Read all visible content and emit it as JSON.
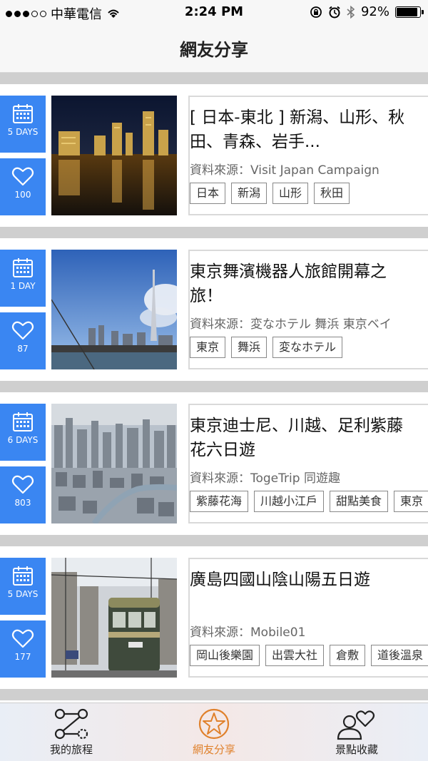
{
  "status": {
    "carrier": "中華電信",
    "time": "2:24 PM",
    "battery": "92%",
    "battery_level": 0.92
  },
  "nav": {
    "title": "網友分享"
  },
  "cards": [
    {
      "days": "5 DAYS",
      "likes": "100",
      "title": "[ 日本-東北 ] 新潟、山形、秋田、青森、岩手...",
      "source": "資料來源：Visit Japan Campaign",
      "tags": [
        "日本",
        "新潟",
        "山形",
        "秋田"
      ]
    },
    {
      "days": "1 DAY",
      "likes": "87",
      "title": "東京舞濱機器人旅館開幕之旅！",
      "source": "資料來源：変なホテル 舞浜 東京ベイ",
      "tags": [
        "東京",
        "舞浜",
        "変なホテル"
      ]
    },
    {
      "days": "6 DAYS",
      "likes": "803",
      "title": "東京迪士尼、川越、足利紫藤花六日遊",
      "source": "資料來源：TogeTrip 同遊趣",
      "tags": [
        "紫藤花海",
        "川越小江戶",
        "甜點美食",
        "東京"
      ]
    },
    {
      "days": "5 DAYS",
      "likes": "177",
      "title": "廣島四國山陰山陽五日遊",
      "source": "資料來源：Mobile01",
      "tags": [
        "岡山後樂園",
        "出雲大社",
        "倉敷",
        "道後溫泉"
      ]
    }
  ],
  "tabbar": {
    "tabs": [
      {
        "label": "我的旅程",
        "icon": "route-icon"
      },
      {
        "label": "網友分享",
        "icon": "star-icon"
      },
      {
        "label": "景點收藏",
        "icon": "user-heart-icon"
      }
    ],
    "active_color": "#e0812c"
  },
  "colors": {
    "accent": "#3a86f2",
    "divider": "#cfcfcf"
  }
}
